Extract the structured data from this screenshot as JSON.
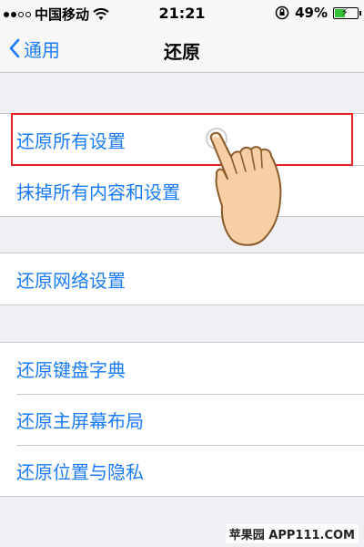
{
  "status_bar": {
    "carrier": "中国移动",
    "time": "21:21",
    "battery_percent": "49%",
    "battery_level": 0.49
  },
  "nav": {
    "back_label": "通用",
    "title": "还原"
  },
  "groups": [
    {
      "items": [
        "还原所有设置",
        "抹掉所有内容和设置"
      ]
    },
    {
      "items": [
        "还原网络设置"
      ]
    },
    {
      "items": [
        "还原键盘字典",
        "还原主屏幕布局",
        "还原位置与隐私"
      ]
    }
  ],
  "highlighted_item": "还原所有设置",
  "watermark": "苹果园 APP111.COM",
  "colors": {
    "accent": "#1b7cf7",
    "highlight": "#e52020",
    "background": "#efeff4"
  }
}
